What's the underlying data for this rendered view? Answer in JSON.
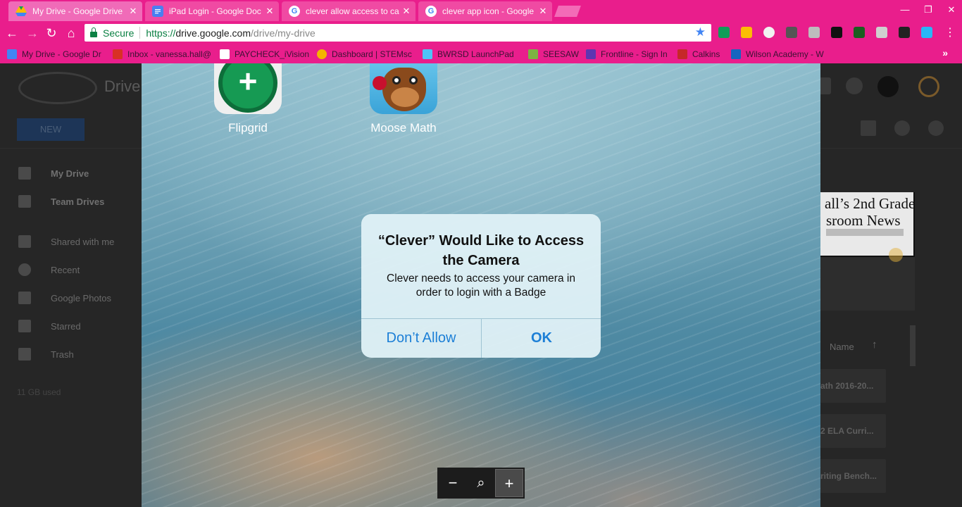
{
  "browser": {
    "tabs": [
      {
        "title": "My Drive - Google Drive",
        "favicon_color": "#4285f4",
        "close": "✕"
      },
      {
        "title": "iPad Login - Google Doc",
        "favicon_color": "#4a7ff0",
        "close": "✕"
      },
      {
        "title": "clever allow access to ca",
        "favicon_color": "#ffffff",
        "close": "✕"
      },
      {
        "title": "clever app icon - Google",
        "favicon_color": "#ffffff",
        "close": "✕"
      }
    ],
    "window_controls": {
      "minimize": "—",
      "maximize": "❐",
      "close": "✕"
    },
    "nav": {
      "back": "←",
      "forward": "→",
      "reload": "↻",
      "home": "⌂"
    },
    "omnibox": {
      "security_label": "Secure",
      "url_scheme": "https://",
      "url_host": "drive.google.com",
      "url_path": "/drive/my-drive",
      "bookmark_star": "★"
    },
    "bookmarks": [
      {
        "label": "My Drive - Google Dr",
        "icon_color": "#4285f4"
      },
      {
        "label": "Inbox - vanessa.hall@",
        "icon_color": "#d93025"
      },
      {
        "label": "PAYCHECK_iVision",
        "icon_color": "#ffffff"
      },
      {
        "label": "Dashboard | STEMsc",
        "icon_color": "#f4b400"
      },
      {
        "label": "BWRSD LaunchPad",
        "icon_color": "#4fc3f7"
      },
      {
        "label": "SEESAW",
        "icon_color": "#7cb342"
      },
      {
        "label": "Frontline - Sign In",
        "icon_color": "#5e35b1"
      },
      {
        "label": "Calkins",
        "icon_color": "#c62828"
      },
      {
        "label": "Wilson Academy - W",
        "icon_color": "#1565c0"
      }
    ],
    "bookmarks_more": "»",
    "accent_color": "#e91e8c"
  },
  "drive": {
    "app_name": "Drive",
    "new_button": "NEW",
    "nav_items": [
      {
        "label": "My Drive",
        "bold": true
      },
      {
        "label": "Team Drives",
        "bold": true
      },
      {
        "label": "Shared with me",
        "bold": false
      },
      {
        "label": "Recent",
        "bold": false
      },
      {
        "label": "Google Photos",
        "bold": false
      },
      {
        "label": "Starred",
        "bold": false
      },
      {
        "label": "Trash",
        "bold": false
      }
    ],
    "storage": "11 GB used",
    "sort_label": "Name",
    "sort_arrow": "↑",
    "preview": {
      "line1": "all’s 2nd Grade",
      "line2": "sroom News"
    },
    "files": [
      "ath 2016-20...",
      "2 ELA Curri...",
      "riting Bench..."
    ]
  },
  "ipad": {
    "apps": [
      {
        "label": "Flipgrid",
        "icon": "flipgrid-app-icon"
      },
      {
        "label": "Moose Math",
        "icon": "moose-math-app-icon"
      }
    ],
    "alert": {
      "title": "“Clever” Would Like to Access the Camera",
      "message": "Clever needs to access your camera in order to login with a Badge",
      "deny_button": "Don’t Allow",
      "ok_button": "OK",
      "button_color": "#1c7fd6"
    },
    "zoom_controls": {
      "zoom_out": "−",
      "zoom_reset": "⌕",
      "zoom_in": "+"
    }
  }
}
